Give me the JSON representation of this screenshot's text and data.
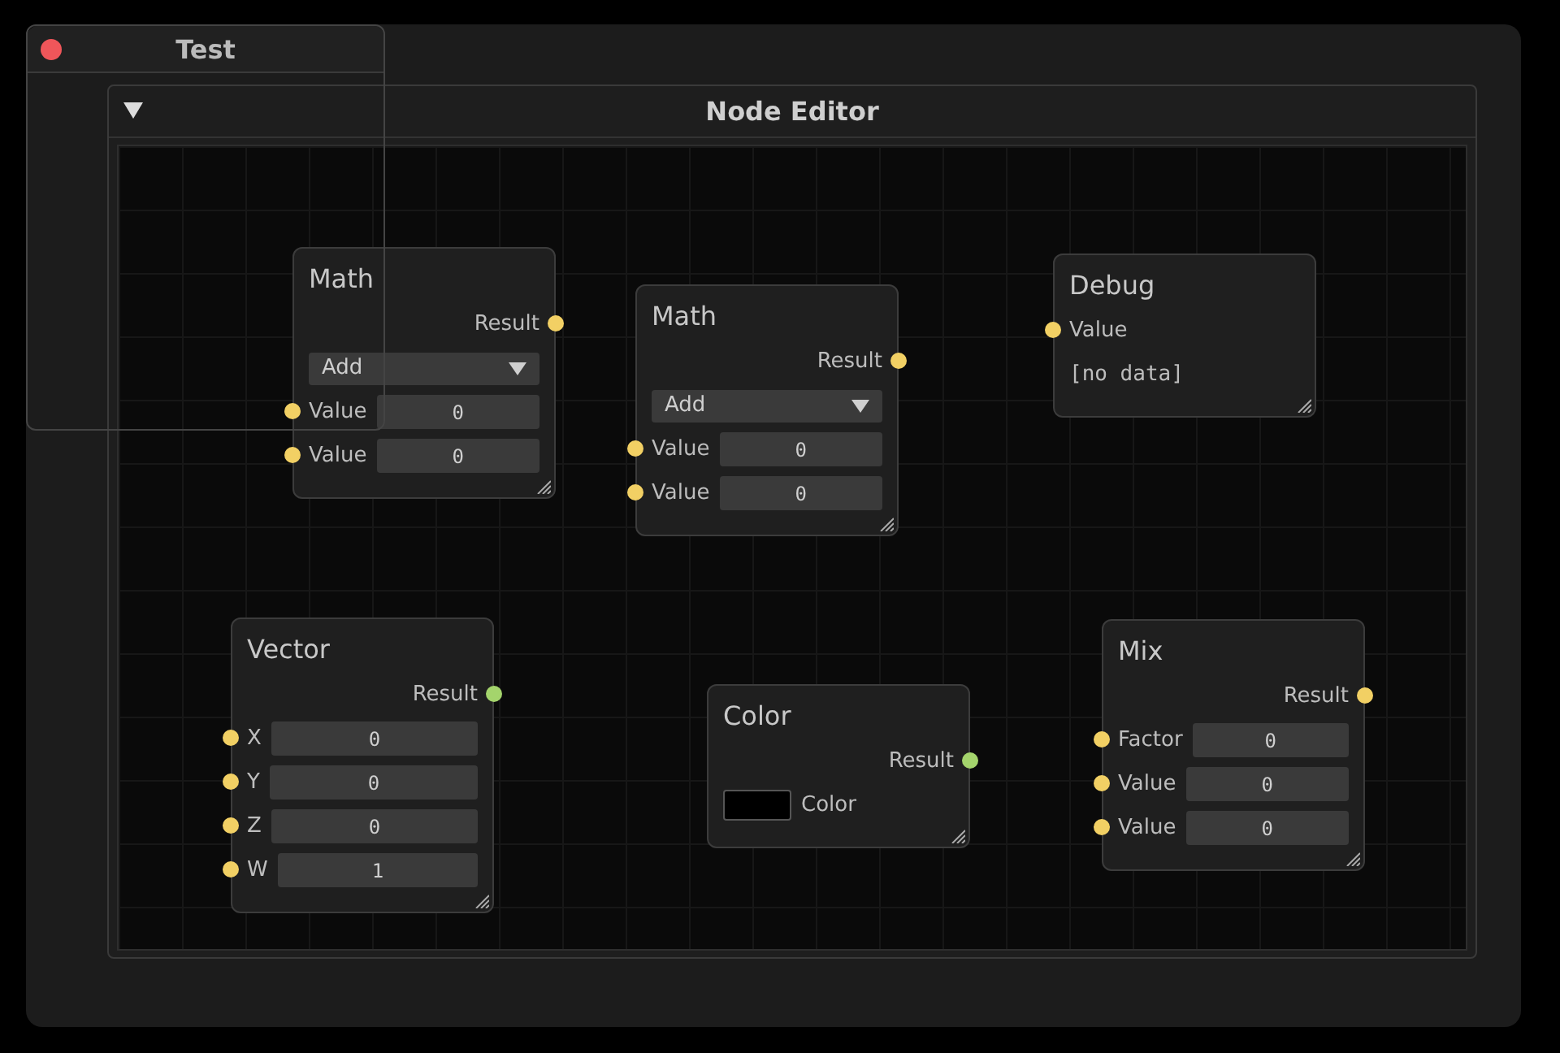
{
  "test_window": {
    "title": "Test"
  },
  "editor": {
    "title": "Node Editor",
    "nodes": [
      {
        "title": "Math",
        "rows": [
          {
            "kind": "output",
            "label": "Result",
            "color": "#f2d064"
          },
          {
            "kind": "dropdown",
            "value": "Add"
          },
          {
            "kind": "input",
            "label": "Value",
            "value": "0",
            "color": "#f2d064"
          },
          {
            "kind": "input",
            "label": "Value",
            "value": "0",
            "color": "#f2d064"
          }
        ]
      },
      {
        "title": "Math",
        "rows": [
          {
            "kind": "output",
            "label": "Result",
            "color": "#f2d064"
          },
          {
            "kind": "dropdown",
            "value": "Add"
          },
          {
            "kind": "input",
            "label": "Value",
            "value": "0",
            "color": "#f2d064"
          },
          {
            "kind": "input",
            "label": "Value",
            "value": "0",
            "color": "#f2d064"
          }
        ]
      },
      {
        "title": "Debug",
        "rows": [
          {
            "kind": "inlet",
            "label": "Value",
            "color": "#f2d064"
          },
          {
            "kind": "text",
            "value": "[no data]"
          }
        ]
      },
      {
        "title": "Vector",
        "rows": [
          {
            "kind": "output",
            "label": "Result",
            "color": "#a4d46c"
          },
          {
            "kind": "input",
            "label": "X",
            "value": "0",
            "color": "#f2d064"
          },
          {
            "kind": "input",
            "label": "Y",
            "value": "0",
            "color": "#f2d064"
          },
          {
            "kind": "input",
            "label": "Z",
            "value": "0",
            "color": "#f2d064"
          },
          {
            "kind": "input",
            "label": "W",
            "value": "1",
            "color": "#f2d064"
          }
        ]
      },
      {
        "title": "Color",
        "rows": [
          {
            "kind": "output",
            "label": "Result",
            "color": "#a4d46c"
          },
          {
            "kind": "swatch",
            "label": "Color",
            "color": "#000000"
          }
        ]
      },
      {
        "title": "Mix",
        "rows": [
          {
            "kind": "output",
            "label": "Result",
            "color": "#f2d064"
          },
          {
            "kind": "input",
            "label": "Factor",
            "value": "0",
            "color": "#f2d064"
          },
          {
            "kind": "input",
            "label": "Value",
            "value": "0",
            "color": "#f2d064"
          },
          {
            "kind": "input",
            "label": "Value",
            "value": "0",
            "color": "#f2d064"
          }
        ]
      }
    ]
  }
}
